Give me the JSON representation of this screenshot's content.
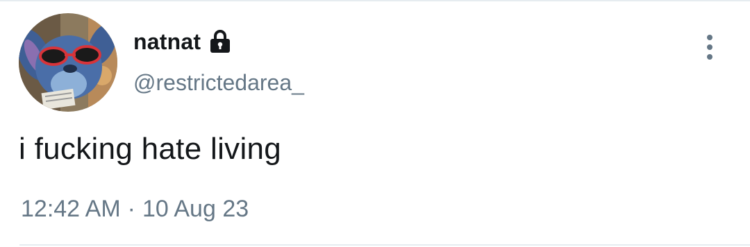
{
  "tweet": {
    "display_name": "natnat",
    "lock_icon": "lock-icon",
    "handle": "@restrictedarea_",
    "text": "i fucking hate living",
    "time": "12:42 AM",
    "separator": "·",
    "date": "10 Aug 23",
    "more_icon": "more-vertical-icon"
  },
  "colors": {
    "text_primary": "#14171a",
    "text_secondary": "#657786",
    "border": "#e6ecf0"
  }
}
